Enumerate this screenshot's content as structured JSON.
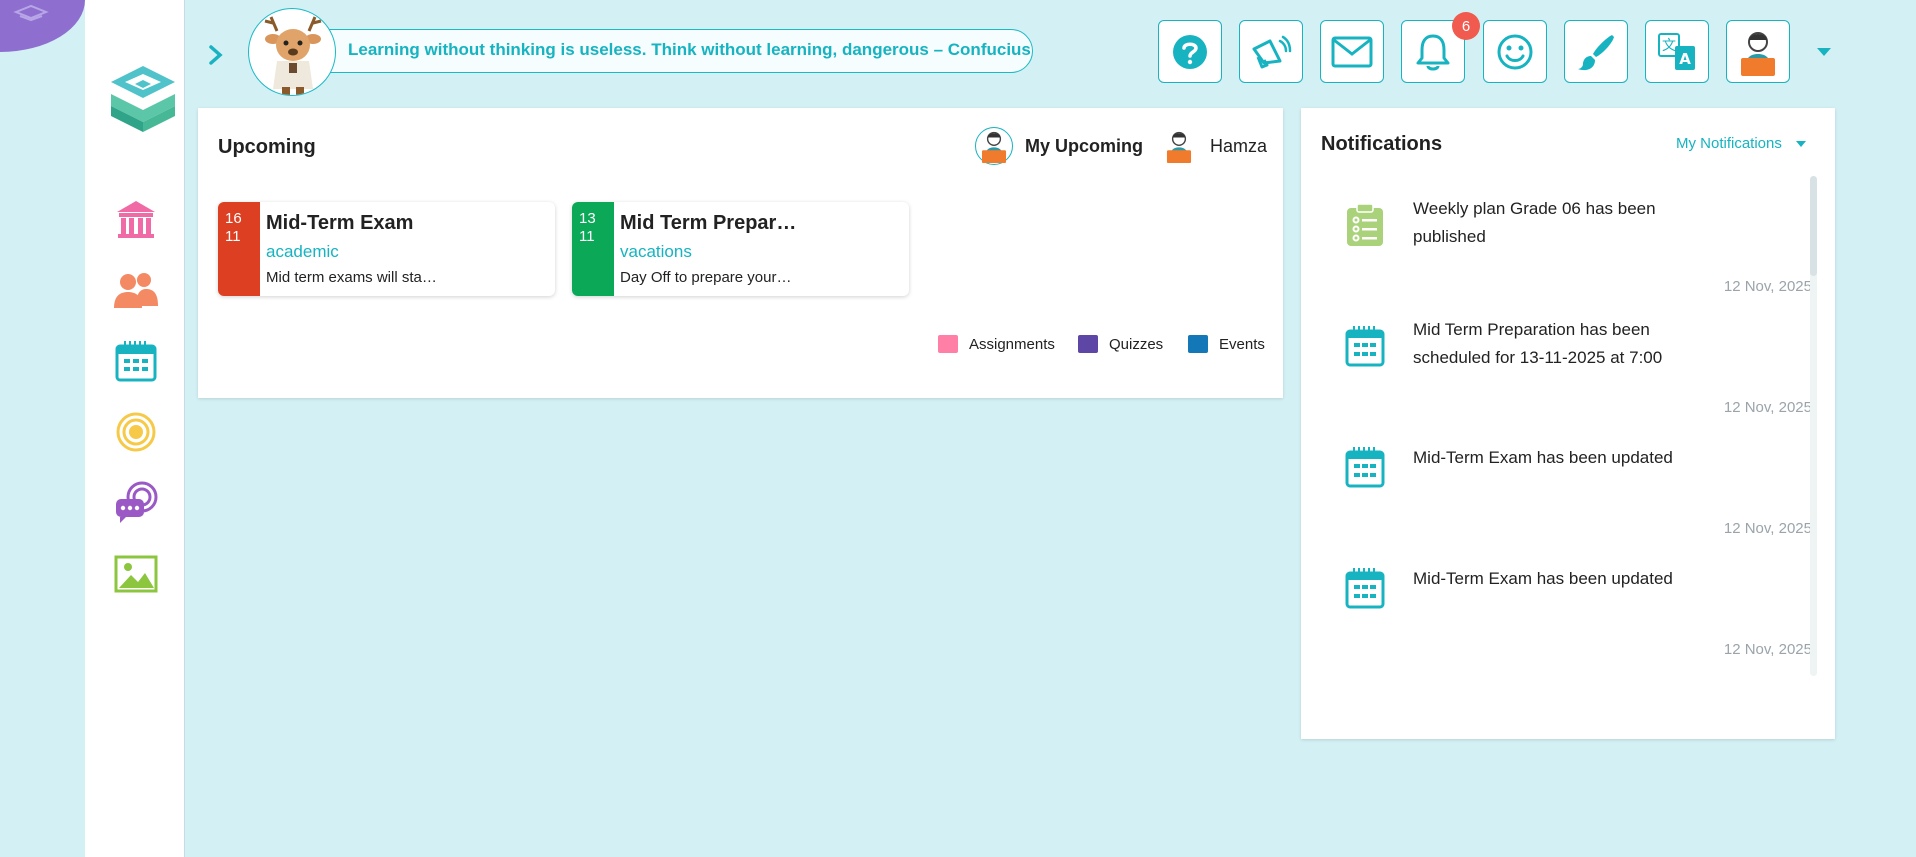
{
  "topbar": {
    "quote": "Learning without thinking is useless. Think without learning, dangerous – Confucius",
    "buttons": [
      "help-icon",
      "megaphone-icon",
      "mail-icon",
      "bell-icon",
      "smiley-icon",
      "brush-icon",
      "translate-icon",
      "user-avatar-icon"
    ],
    "notification_count": "6"
  },
  "sidebar": {
    "items": [
      "school-icon",
      "users-icon",
      "calendar-icon",
      "target-icon",
      "chat-icon",
      "gallery-icon"
    ]
  },
  "upcoming": {
    "title": "Upcoming",
    "my_upcoming_label": "My Upcoming",
    "child_name": "Hamza",
    "events": [
      {
        "day": "16",
        "month": "11",
        "title": "Mid-Term Exam",
        "category": "academic",
        "description": "Mid term exams will sta…",
        "color": "#dd3f22"
      },
      {
        "day": "13",
        "month": "11",
        "title": "Mid Term Prepar…",
        "category": "vacations",
        "description": "Day Off to prepare your…",
        "color": "#0aa857"
      }
    ],
    "legend": [
      {
        "label": "Assignments",
        "color": "#ff7fa7"
      },
      {
        "label": "Quizzes",
        "color": "#5e46a6"
      },
      {
        "label": "Events",
        "color": "#1377b8"
      }
    ]
  },
  "notifications": {
    "title": "Notifications",
    "filter": "My Notifications",
    "items": [
      {
        "icon": "checklist-icon",
        "text": "Weekly plan Grade 06 has been published",
        "date": "12 Nov, 2025"
      },
      {
        "icon": "calendar-icon",
        "text": "Mid Term Preparation has been scheduled for 13-11-2025 at 7:00",
        "date": "12 Nov, 2025"
      },
      {
        "icon": "calendar-icon",
        "text": "Mid-Term Exam has been updated",
        "date": "12 Nov, 2025"
      },
      {
        "icon": "calendar-icon",
        "text": "Mid-Term Exam has been updated",
        "date": "12 Nov, 2025"
      }
    ]
  },
  "colors": {
    "accent": "#18b3c1",
    "background": "#d3f0f4"
  }
}
